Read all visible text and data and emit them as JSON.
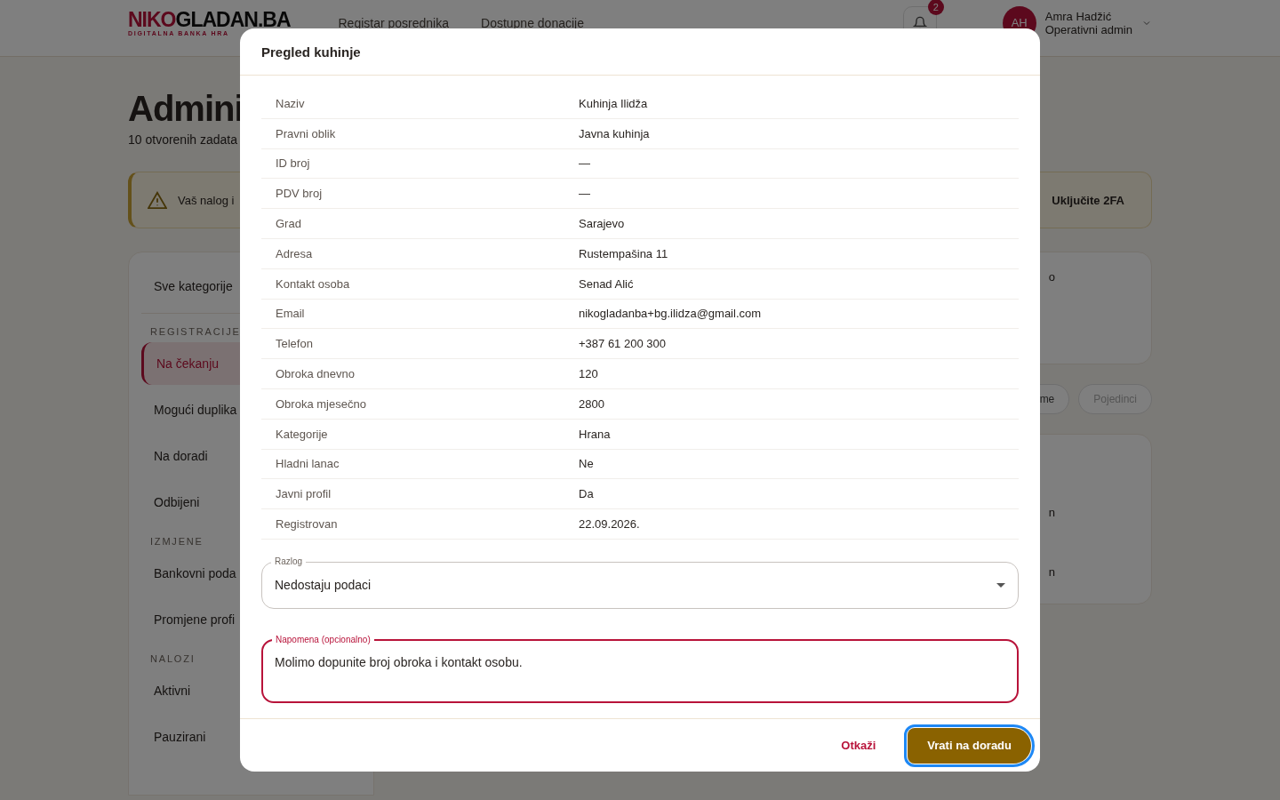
{
  "header": {
    "logo": {
      "primary": "NIKO",
      "secondary": "GLADAN.BA",
      "tagline": "DIGITALNA BANKA HRA"
    },
    "nav": [
      {
        "label": "Registar posrednika"
      },
      {
        "label": "Dostupne donacije"
      }
    ],
    "notifications": {
      "count": "2"
    },
    "user": {
      "initials": "AH",
      "name": "Amra Hadžić",
      "role": "Operativni admin"
    }
  },
  "page": {
    "title": "Admini",
    "subtitle": "10 otvorenih zadata",
    "alert": {
      "text": "Vaš nalog i",
      "action": "Uključite 2FA"
    }
  },
  "sidebar": {
    "all": {
      "label": "Sve kategorije",
      "selected": false
    },
    "sections": [
      {
        "title": "REGISTRACIJE",
        "items": [
          {
            "label": "Na čekanju",
            "selected": true
          },
          {
            "label": "Mogući duplika",
            "selected": false
          },
          {
            "label": "Na doradi",
            "selected": false
          },
          {
            "label": "Odbijeni",
            "selected": false
          }
        ]
      },
      {
        "title": "IZMJENE",
        "items": [
          {
            "label": "Bankovni poda",
            "selected": false
          },
          {
            "label": "Promjene profi",
            "selected": false
          }
        ]
      },
      {
        "title": "NALOZI",
        "items": [
          {
            "label": "Aktivni",
            "selected": false
          },
          {
            "label": "Pauzirani",
            "selected": false
          }
        ]
      }
    ]
  },
  "content": {
    "summary_card": {
      "text": "o"
    },
    "filters": [
      {
        "label": "me",
        "disabled": false
      },
      {
        "label": "Pojedinci",
        "disabled": true
      }
    ],
    "table": {
      "rows": [
        {
          "column_1": "n"
        },
        {
          "column_1": "n"
        }
      ]
    }
  },
  "modal": {
    "title": "Pregled kuhinje",
    "details": [
      {
        "label": "Naziv",
        "value": "Kuhinja Ilidža"
      },
      {
        "label": "Pravni oblik",
        "value": "Javna kuhinja"
      },
      {
        "label": "ID broj",
        "value": "—"
      },
      {
        "label": "PDV broj",
        "value": "—"
      },
      {
        "label": "Grad",
        "value": "Sarajevo"
      },
      {
        "label": "Adresa",
        "value": "Rustempašina 11"
      },
      {
        "label": "Kontakt osoba",
        "value": "Senad Alić"
      },
      {
        "label": "Email",
        "value": "nikogladanba+bg.ilidza@gmail.com"
      },
      {
        "label": "Telefon",
        "value": "+387 61 200 300"
      },
      {
        "label": "Obroka dnevno",
        "value": "120"
      },
      {
        "label": "Obroka mjesečno",
        "value": "2800"
      },
      {
        "label": "Kategorije",
        "value": "Hrana"
      },
      {
        "label": "Hladni lanac",
        "value": "Ne"
      },
      {
        "label": "Javni profil",
        "value": "Da"
      },
      {
        "label": "Registrovan",
        "value": "22.09.2026."
      }
    ],
    "reason": {
      "label": "Razlog",
      "value": "Nedostaju podaci",
      "focused": false
    },
    "note": {
      "label": "Napomena (opcionalno)",
      "value": "Molimo dopunite broj obroka i kontakt osobu.",
      "focused": true
    },
    "buttons": [
      {
        "kind": "text",
        "label": "Otkaži",
        "focused": false
      },
      {
        "kind": "primary",
        "label": "Vrati na doradu",
        "focused": true
      }
    ]
  }
}
